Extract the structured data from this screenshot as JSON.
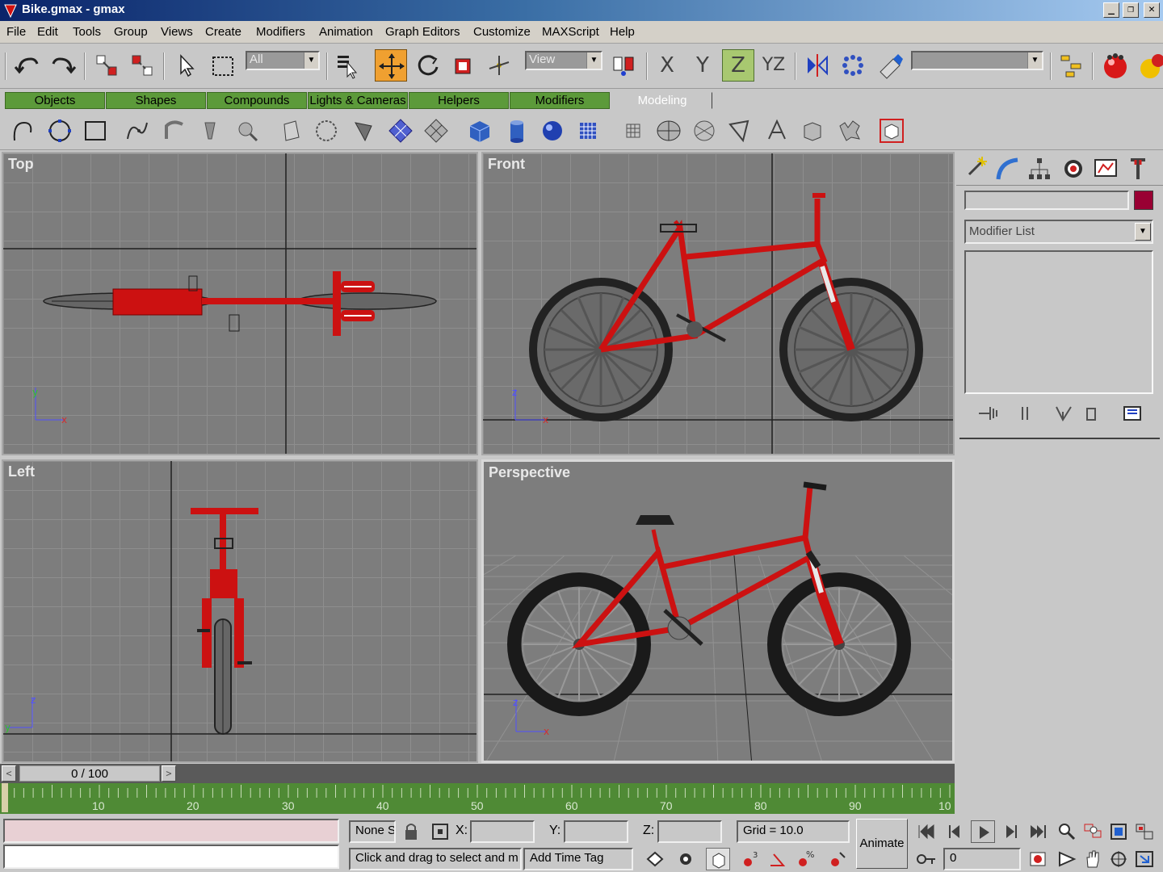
{
  "window": {
    "title": "Bike.gmax - gmax",
    "controls": [
      "_",
      "❐",
      "✕"
    ]
  },
  "menu": [
    "File",
    "Edit",
    "Tools",
    "Group",
    "Views",
    "Create",
    "Modifiers",
    "Animation",
    "Graph Editors",
    "Customize",
    "MAXScript",
    "Help"
  ],
  "toolbar": {
    "selection_filter": "All",
    "reference_coord": "View",
    "axis_x": "X",
    "axis_y": "Y",
    "axis_z": "Z",
    "axis_yz": "YZ",
    "named_selection": ""
  },
  "tabs": [
    {
      "label": "Objects",
      "selected": false
    },
    {
      "label": "Shapes",
      "selected": false
    },
    {
      "label": "Compounds",
      "selected": false
    },
    {
      "label": "Lights & Cameras",
      "selected": false
    },
    {
      "label": "Helpers",
      "selected": false
    },
    {
      "label": "Modifiers",
      "selected": false
    },
    {
      "label": "Modeling",
      "selected": true
    }
  ],
  "viewports": {
    "top": {
      "label": "Top"
    },
    "front": {
      "label": "Front"
    },
    "left": {
      "label": "Left"
    },
    "perspective": {
      "label": "Perspective",
      "active": true
    }
  },
  "command_panel": {
    "object_name": "",
    "object_color": "#990033",
    "modifier_list": "Modifier List"
  },
  "timeline": {
    "frame_display": "0 / 100",
    "prev": "<",
    "next": ">",
    "ticks": [
      "10",
      "20",
      "30",
      "40",
      "50",
      "60",
      "70",
      "80",
      "90",
      "10"
    ]
  },
  "status": {
    "selection_count": "None S",
    "x_label": "X:",
    "y_label": "Y:",
    "z_label": "Z:",
    "x_value": "",
    "y_value": "",
    "z_value": "",
    "grid": "Grid = 10.0",
    "prompt": "Click and drag to select and m",
    "add_time_tag": "Add Time Tag",
    "animate": "Animate",
    "current_frame": "0"
  },
  "colors": {
    "bike_red": "#cc1111",
    "active_tool": "#f0a030",
    "tab_green": "#5c9a3a",
    "viewport_bg": "#7d7d7d"
  }
}
